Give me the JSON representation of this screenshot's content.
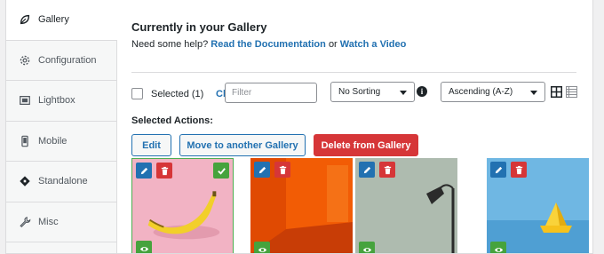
{
  "sidebar": {
    "items": [
      {
        "label": "Gallery",
        "icon": "leaf-icon"
      },
      {
        "label": "Configuration",
        "icon": "gear-icon"
      },
      {
        "label": "Lightbox",
        "icon": "lightbox-icon"
      },
      {
        "label": "Mobile",
        "icon": "mobile-icon"
      },
      {
        "label": "Standalone",
        "icon": "standalone-icon"
      },
      {
        "label": "Misc",
        "icon": "wrench-icon"
      }
    ],
    "active": "Gallery"
  },
  "main": {
    "title": "Currently in your Gallery",
    "help_prefix": "Need some help?",
    "help_link_docs": "Read the Documentation",
    "help_or": "or",
    "help_link_video": "Watch a Video"
  },
  "toolbar": {
    "selected_label": "Selected (1)",
    "clear_label": "Cl",
    "filter_placeholder": "Filter",
    "sorting_value": "No Sorting",
    "order_value": "Ascending (A-Z)",
    "info_glyph": "i"
  },
  "actions": {
    "label": "Selected Actions:",
    "edit": "Edit",
    "move": "Move to another Gallery",
    "delete": "Delete from Gallery"
  },
  "colors": {
    "accent": "#2271b1",
    "danger": "#d63638",
    "success": "#46a33d"
  },
  "images": [
    {
      "name": "banana",
      "selected": true
    },
    {
      "name": "orange-room",
      "selected": false
    },
    {
      "name": "floor-lamp",
      "selected": false
    },
    {
      "name": "paper-boat",
      "selected": false
    }
  ]
}
